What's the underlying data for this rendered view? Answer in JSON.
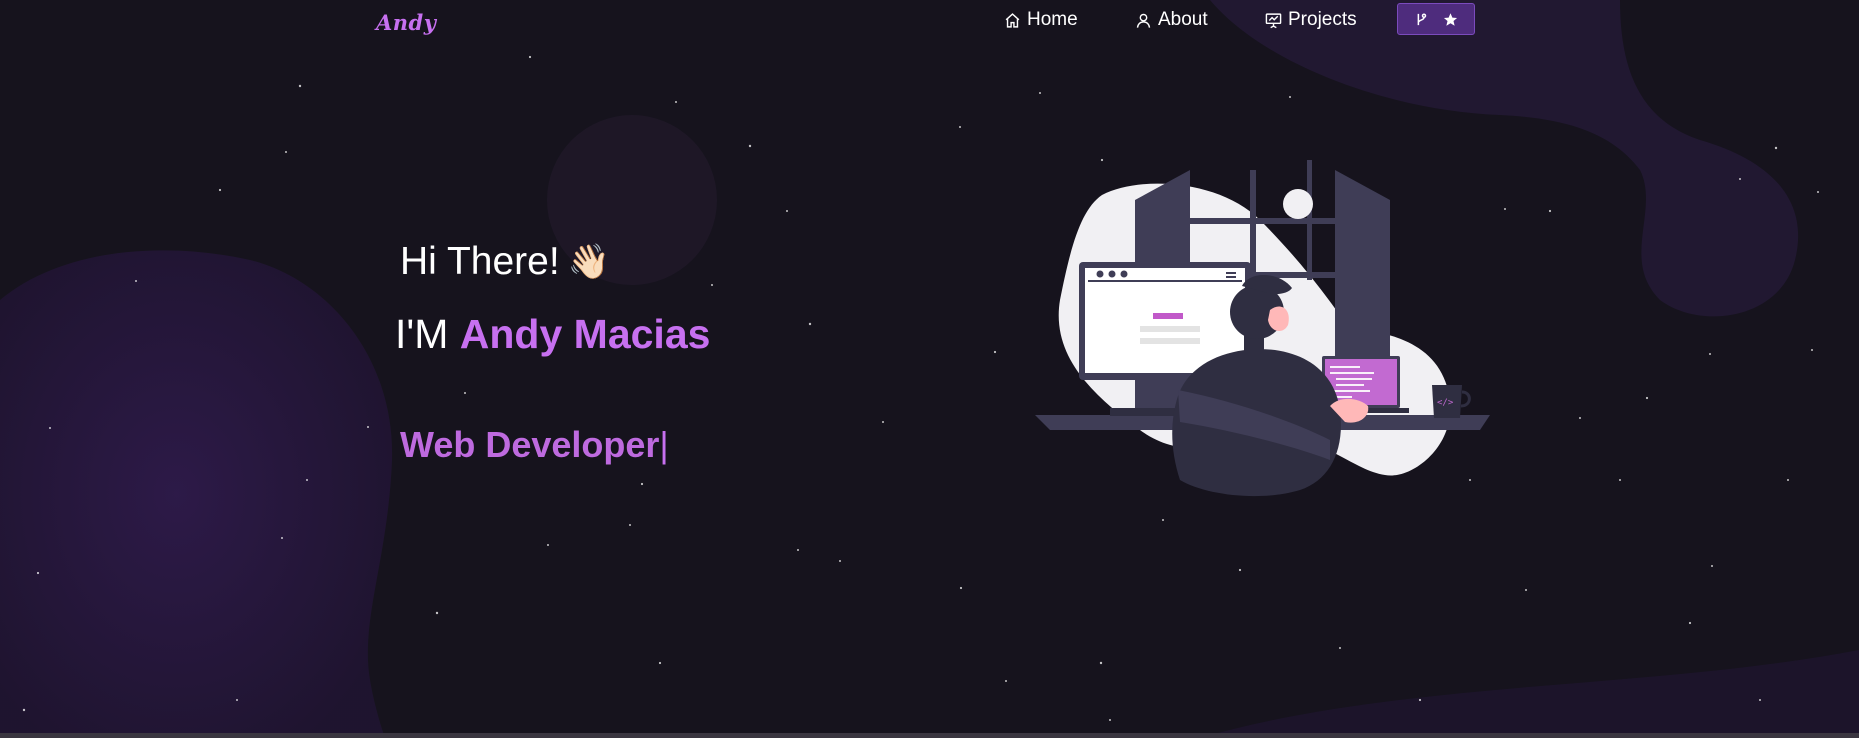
{
  "navbar": {
    "brand": "Andy",
    "items": [
      {
        "label": "Home",
        "icon": "home-icon"
      },
      {
        "label": "About",
        "icon": "user-icon"
      },
      {
        "label": "Projects",
        "icon": "presentation-icon"
      }
    ],
    "github_button": {
      "icons": [
        "git-fork-icon",
        "star-icon"
      ]
    }
  },
  "hero": {
    "greeting": "Hi There!",
    "wave_emoji": "👋🏻",
    "intro_prefix": "I'M",
    "name": "Andy Macias",
    "role": "Web Developer",
    "cursor": "|"
  },
  "colors": {
    "background": "#16131d",
    "accent": "#c770f0",
    "button_bg": "#4e2c7d",
    "blob": "#2a1845"
  }
}
